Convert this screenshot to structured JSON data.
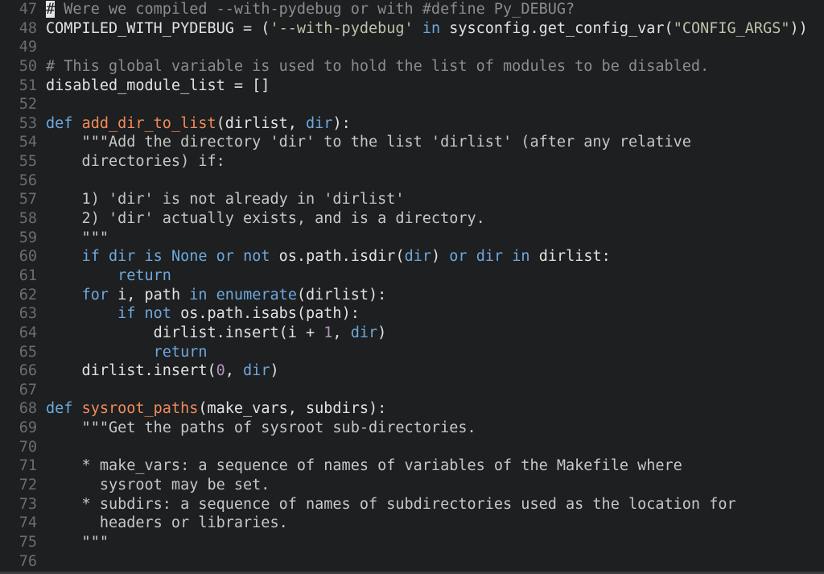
{
  "editor": {
    "lines": [
      {
        "n": "47",
        "tokens": [
          {
            "t": "#",
            "c": "cursor"
          },
          {
            "t": " Were we compiled --with-pydebug or with #define Py_DEBUG?",
            "c": "c-comment"
          }
        ]
      },
      {
        "n": "48",
        "tokens": [
          {
            "t": "COMPILED_WITH_PYDEBUG = (",
            "c": "c-text"
          },
          {
            "t": "'--with-pydebug'",
            "c": "c-str"
          },
          {
            "t": " ",
            "c": "c-text"
          },
          {
            "t": "in",
            "c": "c-kw"
          },
          {
            "t": " sysconfig.get_config_var(",
            "c": "c-text"
          },
          {
            "t": "\"CONFIG_ARGS\"",
            "c": "c-str"
          },
          {
            "t": "))",
            "c": "c-text"
          }
        ]
      },
      {
        "n": "49",
        "tokens": []
      },
      {
        "n": "50",
        "tokens": [
          {
            "t": "# This global variable is used to hold the list of modules to be disabled.",
            "c": "c-comment"
          }
        ]
      },
      {
        "n": "51",
        "tokens": [
          {
            "t": "disabled_module_list = []",
            "c": "c-text"
          }
        ]
      },
      {
        "n": "52",
        "tokens": []
      },
      {
        "n": "53",
        "tokens": [
          {
            "t": "def",
            "c": "c-kw"
          },
          {
            "t": " ",
            "c": "c-text"
          },
          {
            "t": "add_dir_to_list",
            "c": "c-fn"
          },
          {
            "t": "(dirlist, ",
            "c": "c-text"
          },
          {
            "t": "dir",
            "c": "c-builtin"
          },
          {
            "t": "):",
            "c": "c-text"
          }
        ]
      },
      {
        "n": "54",
        "tokens": [
          {
            "t": "    \"\"\"Add the directory 'dir' to the list 'dirlist' (after any relative",
            "c": "c-doc"
          }
        ]
      },
      {
        "n": "55",
        "tokens": [
          {
            "t": "    directories) if:",
            "c": "c-doc"
          }
        ]
      },
      {
        "n": "56",
        "tokens": []
      },
      {
        "n": "57",
        "tokens": [
          {
            "t": "    1) 'dir' is not already in 'dirlist'",
            "c": "c-doc"
          }
        ]
      },
      {
        "n": "58",
        "tokens": [
          {
            "t": "    2) 'dir' actually exists, and is a directory.",
            "c": "c-doc"
          }
        ]
      },
      {
        "n": "59",
        "tokens": [
          {
            "t": "    \"\"\"",
            "c": "c-doc"
          }
        ]
      },
      {
        "n": "60",
        "tokens": [
          {
            "t": "    ",
            "c": "c-text"
          },
          {
            "t": "if",
            "c": "c-kw"
          },
          {
            "t": " ",
            "c": "c-text"
          },
          {
            "t": "dir",
            "c": "c-builtin"
          },
          {
            "t": " ",
            "c": "c-text"
          },
          {
            "t": "is",
            "c": "c-kw"
          },
          {
            "t": " ",
            "c": "c-text"
          },
          {
            "t": "None",
            "c": "c-kw"
          },
          {
            "t": " ",
            "c": "c-text"
          },
          {
            "t": "or",
            "c": "c-kw"
          },
          {
            "t": " ",
            "c": "c-text"
          },
          {
            "t": "not",
            "c": "c-kw"
          },
          {
            "t": " os.path.isdir(",
            "c": "c-text"
          },
          {
            "t": "dir",
            "c": "c-builtin"
          },
          {
            "t": ") ",
            "c": "c-text"
          },
          {
            "t": "or",
            "c": "c-kw"
          },
          {
            "t": " ",
            "c": "c-text"
          },
          {
            "t": "dir",
            "c": "c-builtin"
          },
          {
            "t": " ",
            "c": "c-text"
          },
          {
            "t": "in",
            "c": "c-kw"
          },
          {
            "t": " dirlist:",
            "c": "c-text"
          }
        ]
      },
      {
        "n": "61",
        "tokens": [
          {
            "t": "        ",
            "c": "c-text"
          },
          {
            "t": "return",
            "c": "c-kw"
          }
        ]
      },
      {
        "n": "62",
        "tokens": [
          {
            "t": "    ",
            "c": "c-text"
          },
          {
            "t": "for",
            "c": "c-kw"
          },
          {
            "t": " i, path ",
            "c": "c-text"
          },
          {
            "t": "in",
            "c": "c-kw"
          },
          {
            "t": " ",
            "c": "c-text"
          },
          {
            "t": "enumerate",
            "c": "c-builtin"
          },
          {
            "t": "(dirlist):",
            "c": "c-text"
          }
        ]
      },
      {
        "n": "63",
        "tokens": [
          {
            "t": "        ",
            "c": "c-text"
          },
          {
            "t": "if",
            "c": "c-kw"
          },
          {
            "t": " ",
            "c": "c-text"
          },
          {
            "t": "not",
            "c": "c-kw"
          },
          {
            "t": " os.path.isabs(path):",
            "c": "c-text"
          }
        ]
      },
      {
        "n": "64",
        "tokens": [
          {
            "t": "            dirlist.insert(i + ",
            "c": "c-text"
          },
          {
            "t": "1",
            "c": "c-num"
          },
          {
            "t": ", ",
            "c": "c-text"
          },
          {
            "t": "dir",
            "c": "c-builtin"
          },
          {
            "t": ")",
            "c": "c-text"
          }
        ]
      },
      {
        "n": "65",
        "tokens": [
          {
            "t": "            ",
            "c": "c-text"
          },
          {
            "t": "return",
            "c": "c-kw"
          }
        ]
      },
      {
        "n": "66",
        "tokens": [
          {
            "t": "    dirlist.insert(",
            "c": "c-text"
          },
          {
            "t": "0",
            "c": "c-num"
          },
          {
            "t": ", ",
            "c": "c-text"
          },
          {
            "t": "dir",
            "c": "c-builtin"
          },
          {
            "t": ")",
            "c": "c-text"
          }
        ]
      },
      {
        "n": "67",
        "tokens": []
      },
      {
        "n": "68",
        "tokens": [
          {
            "t": "def",
            "c": "c-kw"
          },
          {
            "t": " ",
            "c": "c-text"
          },
          {
            "t": "sysroot_paths",
            "c": "c-fn"
          },
          {
            "t": "(make_vars, subdirs):",
            "c": "c-text"
          }
        ]
      },
      {
        "n": "69",
        "tokens": [
          {
            "t": "    \"\"\"Get the paths of sysroot sub-directories.",
            "c": "c-doc"
          }
        ]
      },
      {
        "n": "70",
        "tokens": []
      },
      {
        "n": "71",
        "tokens": [
          {
            "t": "    * make_vars: a sequence of names of variables of the Makefile where",
            "c": "c-doc"
          }
        ]
      },
      {
        "n": "72",
        "tokens": [
          {
            "t": "      sysroot may be set.",
            "c": "c-doc"
          }
        ]
      },
      {
        "n": "73",
        "tokens": [
          {
            "t": "    * subdirs: a sequence of names of subdirectories used as the location for",
            "c": "c-doc"
          }
        ]
      },
      {
        "n": "74",
        "tokens": [
          {
            "t": "      headers or libraries.",
            "c": "c-doc"
          }
        ]
      },
      {
        "n": "75",
        "tokens": [
          {
            "t": "    \"\"\"",
            "c": "c-doc"
          }
        ]
      },
      {
        "n": "76",
        "tokens": []
      }
    ]
  }
}
